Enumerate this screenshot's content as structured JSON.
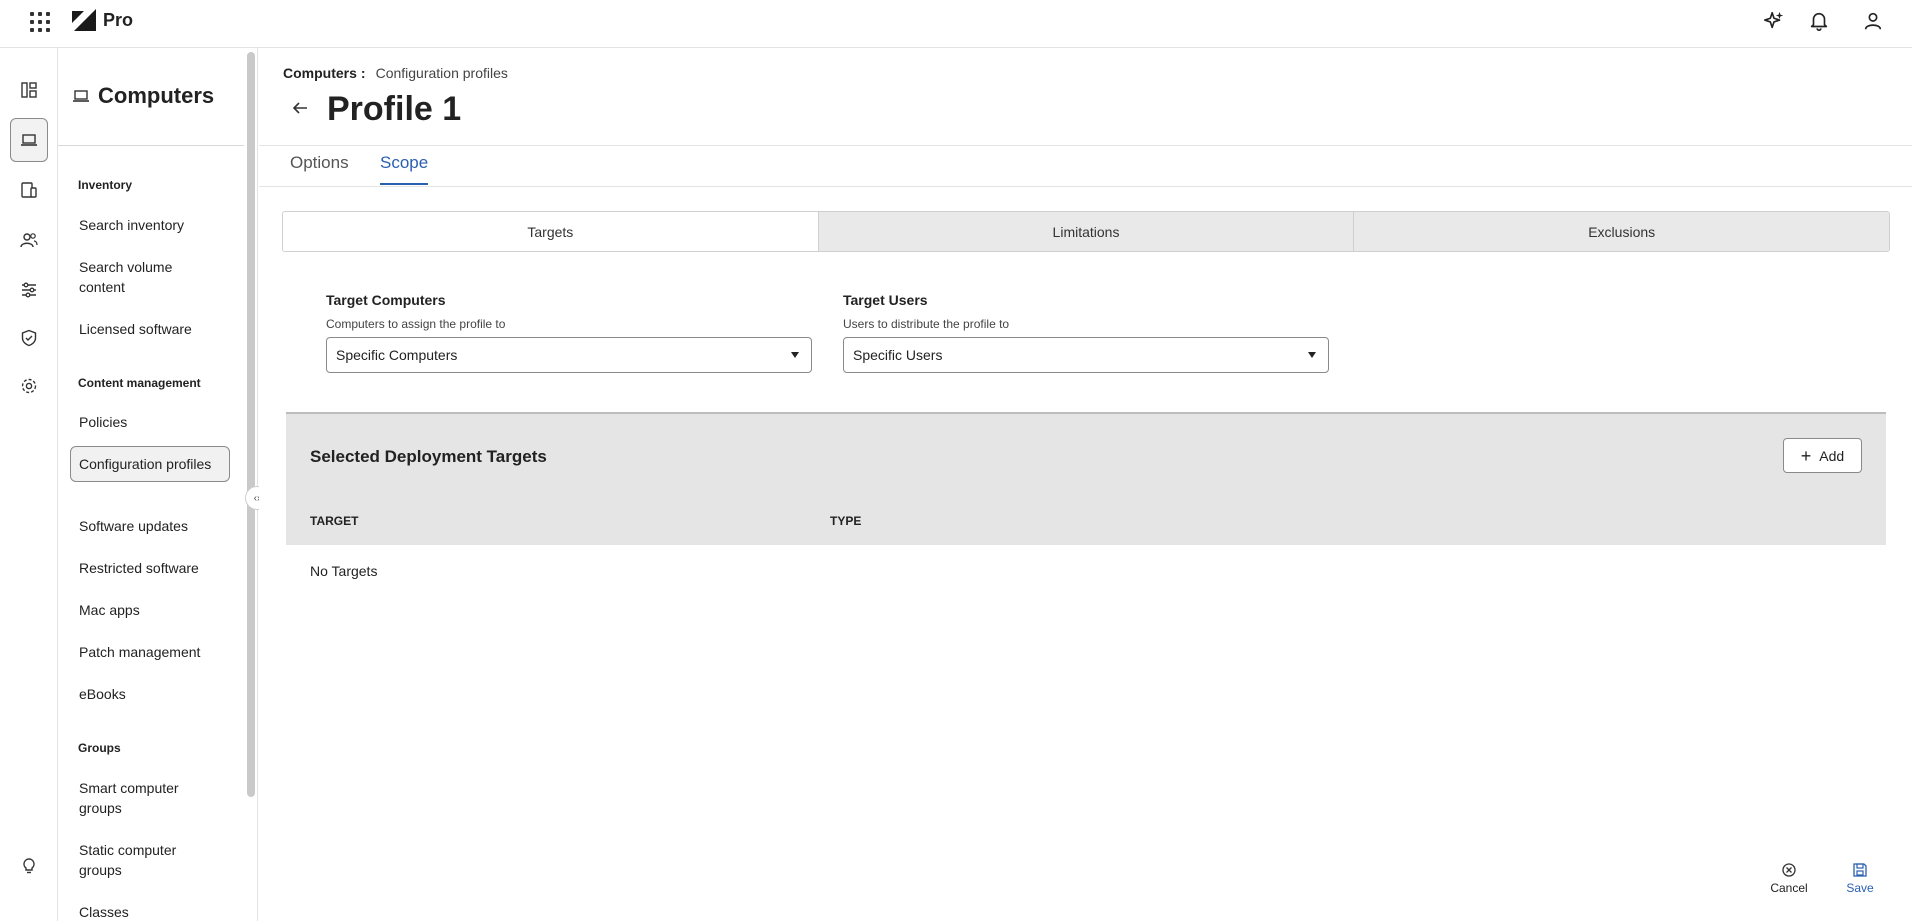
{
  "topbar": {
    "brand": "Pro"
  },
  "nav": {
    "title": "Computers",
    "sections": {
      "inventory": "Inventory",
      "content": "Content management",
      "groups": "Groups"
    },
    "items": {
      "search_inventory": "Search inventory",
      "search_volume": "Search volume content",
      "licensed": "Licensed software",
      "policies": "Policies",
      "config_profiles": "Configuration profiles",
      "software_updates": "Software updates",
      "restricted": "Restricted software",
      "mac_apps": "Mac apps",
      "patch": "Patch management",
      "ebooks": "eBooks",
      "smart_groups": "Smart computer groups",
      "static_groups": "Static computer groups",
      "classes": "Classes"
    }
  },
  "breadcrumb": {
    "root": "Computers",
    "separator": ":",
    "current": "Configuration profiles"
  },
  "page": {
    "title": "Profile 1"
  },
  "tabs": {
    "options": "Options",
    "scope": "Scope"
  },
  "segments": {
    "targets": "Targets",
    "limitations": "Limitations",
    "exclusions": "Exclusions"
  },
  "target_computers": {
    "label": "Target Computers",
    "sub": "Computers to assign the profile to",
    "value": "Specific Computers"
  },
  "target_users": {
    "label": "Target Users",
    "sub": "Users to distribute the profile to",
    "value": "Specific Users"
  },
  "deployment": {
    "title": "Selected Deployment Targets",
    "add_label": "Add",
    "col_target": "TARGET",
    "col_type": "TYPE",
    "empty": "No Targets"
  },
  "footer": {
    "cancel": "Cancel",
    "save": "Save"
  },
  "colors": {
    "accent": "#2a5fb0",
    "panel": "#e5e5e5"
  }
}
